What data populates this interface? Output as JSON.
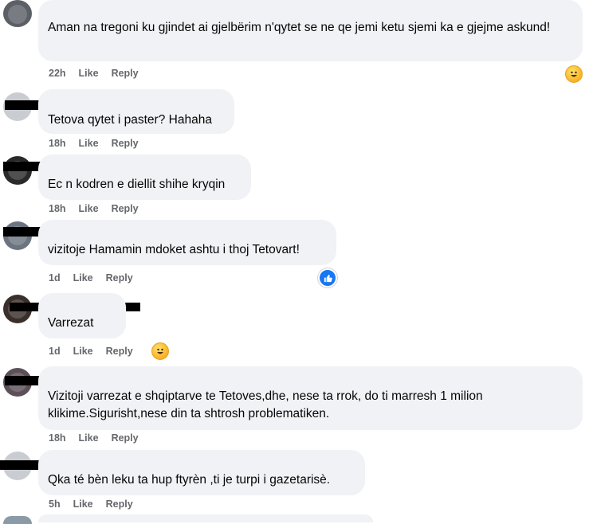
{
  "comments": [
    {
      "time": "22h",
      "like": "Like",
      "reply": "Reply",
      "text": "Aman na tregoni ku gjindet ai gjelbërim n'qytet se ne qe jemi ketu sjemi ka e gjejme askund!",
      "reaction": "haha-icon"
    },
    {
      "time": "18h",
      "like": "Like",
      "reply": "Reply",
      "text": "Tetova qytet i paster? Hahaha"
    },
    {
      "time": "18h",
      "like": "Like",
      "reply": "Reply",
      "text": "Ec n kodren e diellit shihe kryqin"
    },
    {
      "time": "1d",
      "like": "Like",
      "reply": "Reply",
      "text": "vizitoje Hamamin mdoket ashtu i thoj Tetovart!",
      "reaction": "like-icon"
    },
    {
      "time": "1d",
      "like": "Like",
      "reply": "Reply",
      "text": "Varrezat",
      "reaction": "haha-icon"
    },
    {
      "time": "18h",
      "like": "Like",
      "reply": "Reply",
      "text": "Vizitoji varrezat e shqiptarve te Tetoves,dhe, nese ta rrok, do ti marresh 1 milion klikime.Sigurisht,nese din ta shtrosh problematiken."
    },
    {
      "time": "5h",
      "like": "Like",
      "reply": "Reply",
      "text": "Qka té bèn leku ta hup ftyrèn ,ti je turpi i gazetarisè."
    }
  ],
  "colors": {
    "bubble": "#f0f2f5",
    "meta": "#65676b",
    "like_blue": "#1877f2"
  }
}
